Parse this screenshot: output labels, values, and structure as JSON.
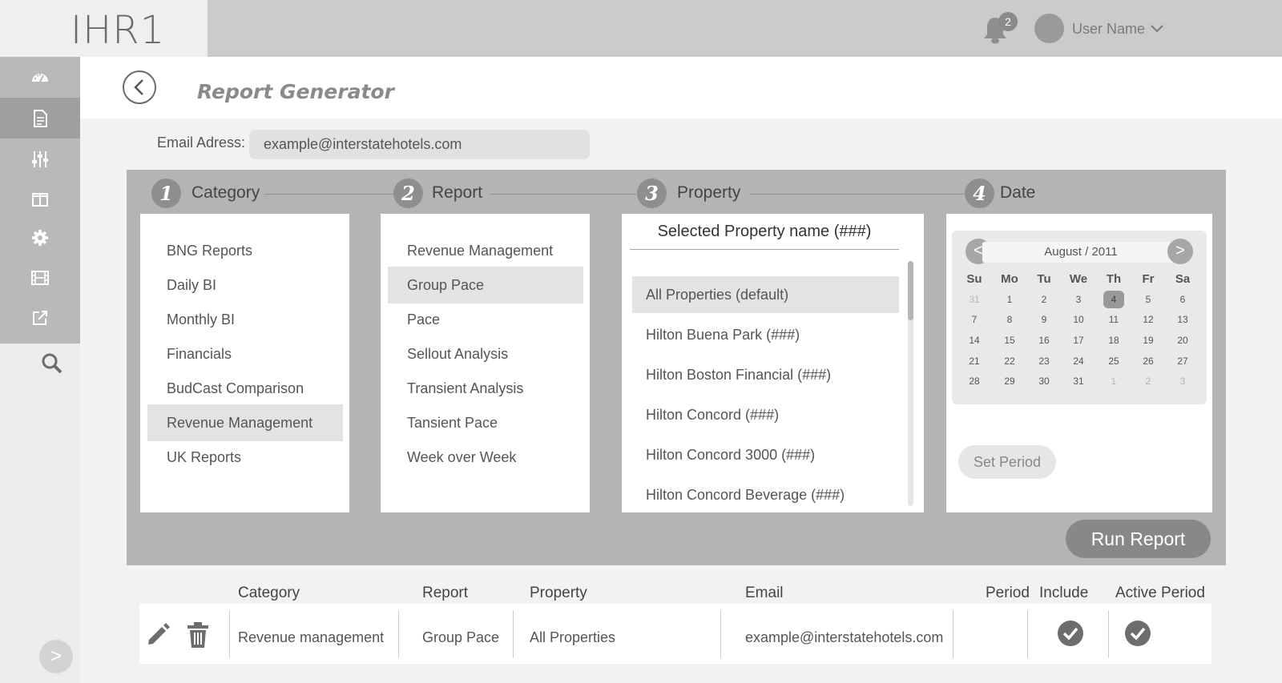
{
  "app": {
    "logo": "IHR1"
  },
  "header": {
    "notifications_count": "2",
    "user_name": "User Name"
  },
  "sidebar": {
    "items": [
      {
        "icon": "dashboard-icon"
      },
      {
        "icon": "document-icon",
        "active": true
      },
      {
        "icon": "sliders-icon"
      },
      {
        "icon": "columns-icon"
      },
      {
        "icon": "gear-icon"
      },
      {
        "icon": "film-icon"
      },
      {
        "icon": "external-link-icon"
      }
    ],
    "search_icon": "search-icon",
    "expand_label": ">"
  },
  "page": {
    "title": "Report Generator"
  },
  "email": {
    "label": "Email Adress:",
    "value": "example@interstatehotels.com"
  },
  "steps": [
    {
      "number": "1",
      "label": "Category"
    },
    {
      "number": "2",
      "label": "Report"
    },
    {
      "number": "3",
      "label": "Property"
    },
    {
      "number": "4",
      "label": "Date"
    }
  ],
  "categories": {
    "items": [
      "BNG Reports",
      "Daily BI",
      "Monthly BI",
      "Financials",
      "BudCast Comparison",
      "Revenue Management",
      "UK Reports"
    ],
    "selected_index": 5
  },
  "reports": {
    "items": [
      "Revenue Management",
      "Group Pace",
      "Pace",
      "Sellout Analysis",
      "Transient Analysis",
      "Tansient Pace",
      "Week over Week"
    ],
    "selected_index": 1
  },
  "property": {
    "title": "Selected Property name (###)",
    "items": [
      "All Properties (default)",
      "Hilton Buena Park (###)",
      "Hilton Boston Financial (###)",
      "Hilton Concord (###)",
      "Hilton Concord 3000 (###)",
      "Hilton Concord Beverage (###)"
    ],
    "selected_index": 0
  },
  "calendar": {
    "prev": "<",
    "next": ">",
    "month": "August / 2011",
    "weekdays": [
      "Su",
      "Mo",
      "Tu",
      "We",
      "Th",
      "Fr",
      "Sa"
    ],
    "weeks": [
      [
        "31",
        "1",
        "2",
        "3",
        "4",
        "5",
        "6"
      ],
      [
        "7",
        "8",
        "9",
        "10",
        "11",
        "12",
        "13"
      ],
      [
        "14",
        "15",
        "16",
        "17",
        "18",
        "19",
        "20"
      ],
      [
        "21",
        "22",
        "23",
        "24",
        "25",
        "26",
        "27"
      ],
      [
        "28",
        "29",
        "30",
        "31",
        "1",
        "2",
        "3"
      ]
    ],
    "selected_day": "4",
    "set_period_label": "Set Period"
  },
  "actions": {
    "run_report_label": "Run Report"
  },
  "table": {
    "headers": {
      "category": "Category",
      "report": "Report",
      "property": "Property",
      "email": "Email",
      "period": "Period",
      "include": "Include",
      "active_period": "Active Period"
    },
    "rows": [
      {
        "category": "Revenue management",
        "report": "Group Pace",
        "property": "All Properties",
        "email": "example@interstatehotels.com",
        "period": "",
        "include": true,
        "active_period": true
      }
    ]
  }
}
